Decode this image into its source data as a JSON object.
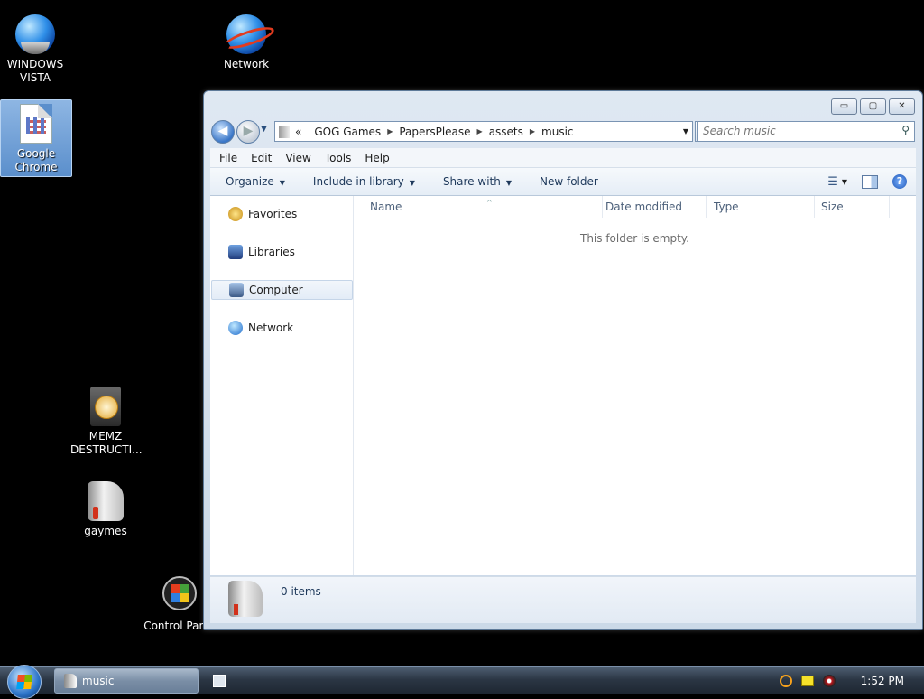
{
  "desktop": {
    "icons": [
      {
        "label_line1": "WINDOWS",
        "label_line2": "VISTA"
      },
      {
        "label_line1": "Network",
        "label_line2": ""
      },
      {
        "label_line1": "Google",
        "label_line2": "Chrome"
      },
      {
        "label_line1": "MEMZ",
        "label_line2": "DESTRUCTI..."
      },
      {
        "label_line1": "gaymes",
        "label_line2": ""
      },
      {
        "label_line1": "Control Panel",
        "label_line2": ""
      }
    ]
  },
  "window": {
    "caption_buttons": {
      "minimize": "▭",
      "maximize": "▢",
      "close": "✕"
    },
    "nav": {
      "back": "◀",
      "forward": "▶",
      "history": "▼"
    },
    "address": {
      "overflow": "«",
      "crumbs": [
        "GOG Games",
        "PapersPlease",
        "assets",
        "music"
      ],
      "dropdown": "▼",
      "refresh": "⟳"
    },
    "search": {
      "placeholder": "Search music",
      "icon": "⚲"
    },
    "menu": [
      "File",
      "Edit",
      "View",
      "Tools",
      "Help"
    ],
    "toolbar": {
      "organize": "Organize",
      "include_in_library": "Include in library",
      "share_with": "Share with",
      "new_folder": "New folder",
      "arrow": "▼",
      "views_arrow": "▼",
      "help": "?"
    },
    "nav_pane": [
      "Favorites",
      "Libraries",
      "Computer",
      "Network"
    ],
    "nav_pane_selected": "Computer",
    "columns": [
      "Name",
      "Date modified",
      "Type",
      "Size"
    ],
    "sort_indicator": "^",
    "empty_message": "This folder is empty.",
    "details": {
      "item_count": "0 items"
    }
  },
  "taskbar": {
    "task_label": "music",
    "clock": "1:52 PM"
  }
}
